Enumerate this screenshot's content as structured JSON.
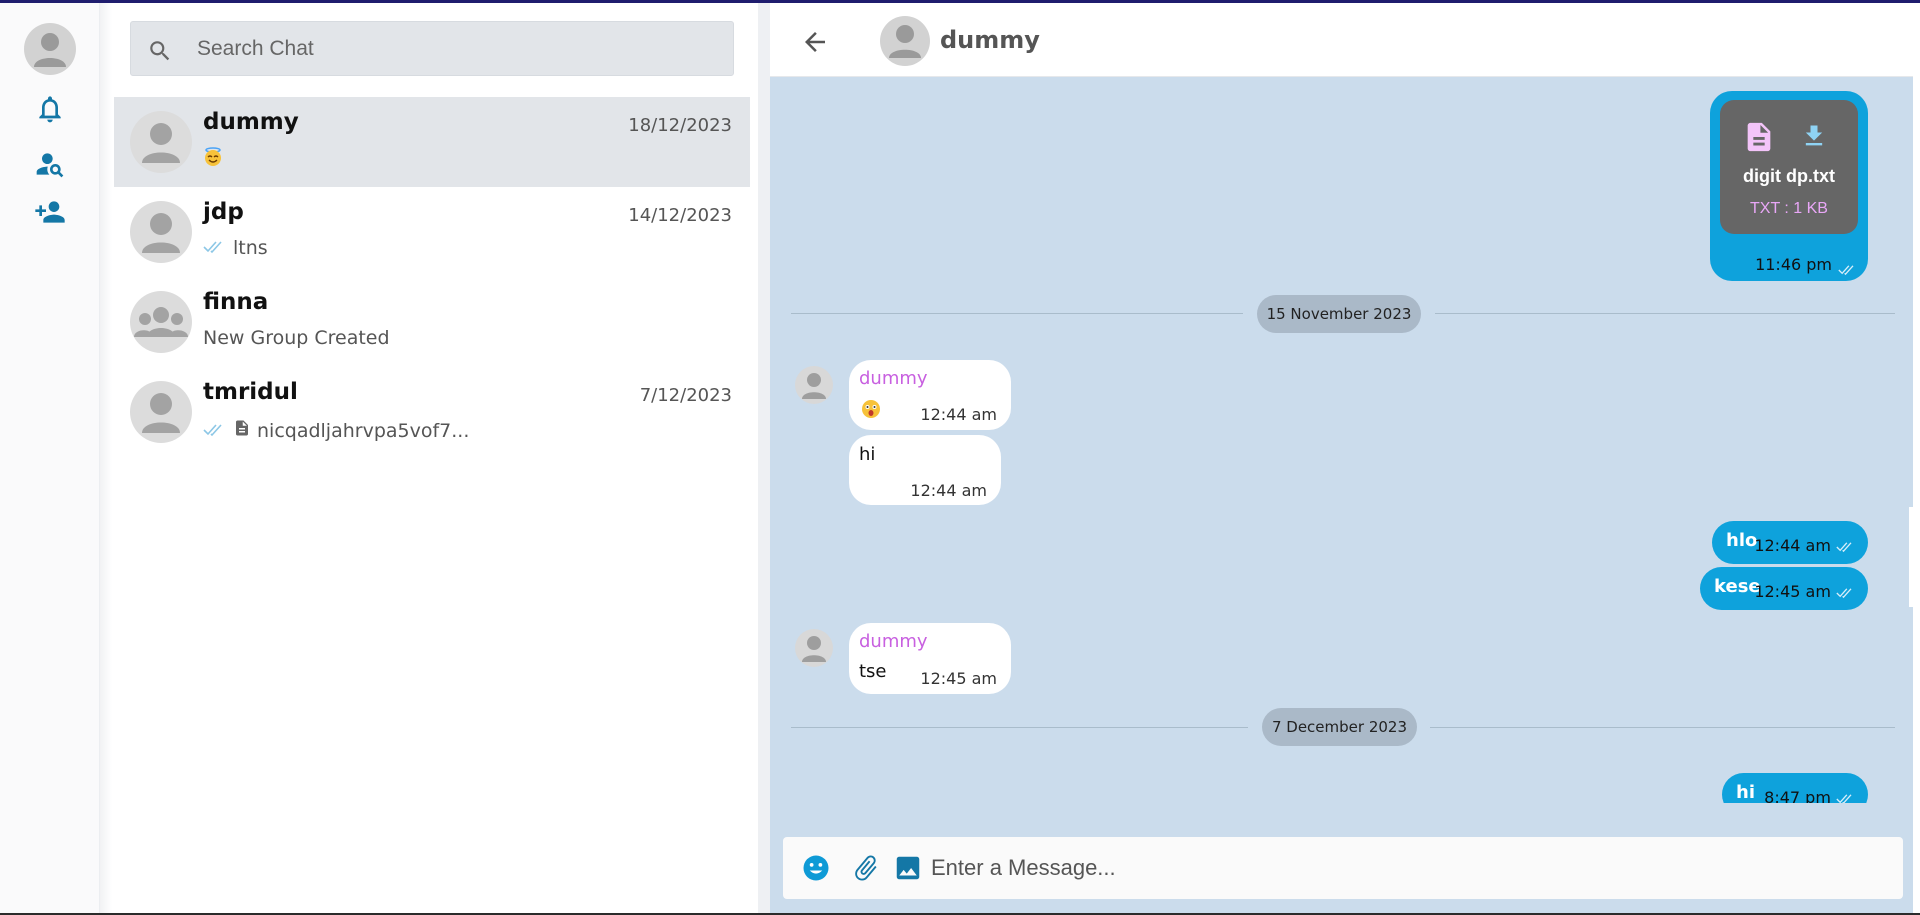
{
  "search": {
    "placeholder": "Search Chat"
  },
  "rail": {
    "icons": [
      "profile-avatar",
      "bell-icon",
      "find-user-icon",
      "add-user-icon"
    ]
  },
  "chats": [
    {
      "name": "dummy",
      "date": "18/12/2023",
      "preview": "",
      "preview_emoji": "smiling-face-with-halo",
      "ticks": false,
      "file_icon": false,
      "active": true
    },
    {
      "name": "jdp",
      "date": "14/12/2023",
      "preview": "ltns",
      "ticks": true,
      "file_icon": false,
      "active": false
    },
    {
      "name": "finna",
      "date": "",
      "preview": "New Group Created",
      "ticks": false,
      "file_icon": false,
      "group": true,
      "active": false
    },
    {
      "name": "tmridul",
      "date": "7/12/2023",
      "preview": "nicqadljahrvpa5vof7...",
      "ticks": true,
      "file_icon": true,
      "active": false
    }
  ],
  "conversation": {
    "title": "dummy",
    "file_message": {
      "filename": "digit dp.txt",
      "meta": "TXT : 1 KB",
      "time": "11:46 pm"
    },
    "date_separators": [
      "15 November 2023",
      "7 December 2023"
    ],
    "messages": [
      {
        "direction": "in",
        "sender": "dummy",
        "text": "",
        "emoji": "astonished-face",
        "time": "12:44 am"
      },
      {
        "direction": "in",
        "sender": "",
        "text": "hi",
        "time": "12:44 am"
      },
      {
        "direction": "out",
        "text": "hlo",
        "time": "12:44 am"
      },
      {
        "direction": "out",
        "text": "kese",
        "time": "12:45 am"
      },
      {
        "direction": "in",
        "sender": "dummy",
        "text": "tse",
        "time": "12:45 am"
      },
      {
        "direction": "out",
        "text": "hi",
        "time": "8:47 pm"
      }
    ]
  },
  "composer": {
    "placeholder": "Enter a Message..."
  },
  "colors": {
    "accent": "#0ea2dc",
    "conversation_bg": "#cbdcec",
    "sender_name": "#c860e0",
    "rail_icon": "#1477a6"
  }
}
